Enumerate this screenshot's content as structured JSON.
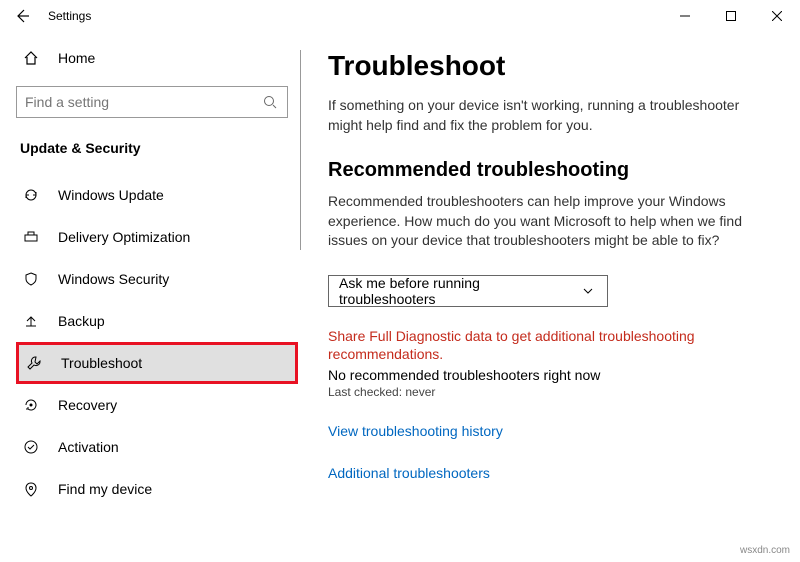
{
  "titlebar": {
    "title": "Settings"
  },
  "sidebar": {
    "home": "Home",
    "search_placeholder": "Find a setting",
    "section": "Update & Security",
    "items": [
      {
        "label": "Windows Update"
      },
      {
        "label": "Delivery Optimization"
      },
      {
        "label": "Windows Security"
      },
      {
        "label": "Backup"
      },
      {
        "label": "Troubleshoot"
      },
      {
        "label": "Recovery"
      },
      {
        "label": "Activation"
      },
      {
        "label": "Find my device"
      }
    ]
  },
  "main": {
    "title": "Troubleshoot",
    "intro": "If something on your device isn't working, running a troubleshooter might help find and fix the problem for you.",
    "section_title": "Recommended troubleshooting",
    "section_body": "Recommended troubleshooters can help improve your Windows experience. How much do you want Microsoft to help when we find issues on your device that troubleshooters might be able to fix?",
    "dropdown_value": "Ask me before running troubleshooters",
    "warn": "Share Full Diagnostic data to get additional troubleshooting recommendations.",
    "no_rec": "No recommended troubleshooters right now",
    "last_checked": "Last checked: never",
    "link_history": "View troubleshooting history",
    "link_additional": "Additional troubleshooters"
  },
  "footer": "wsxdn.com"
}
